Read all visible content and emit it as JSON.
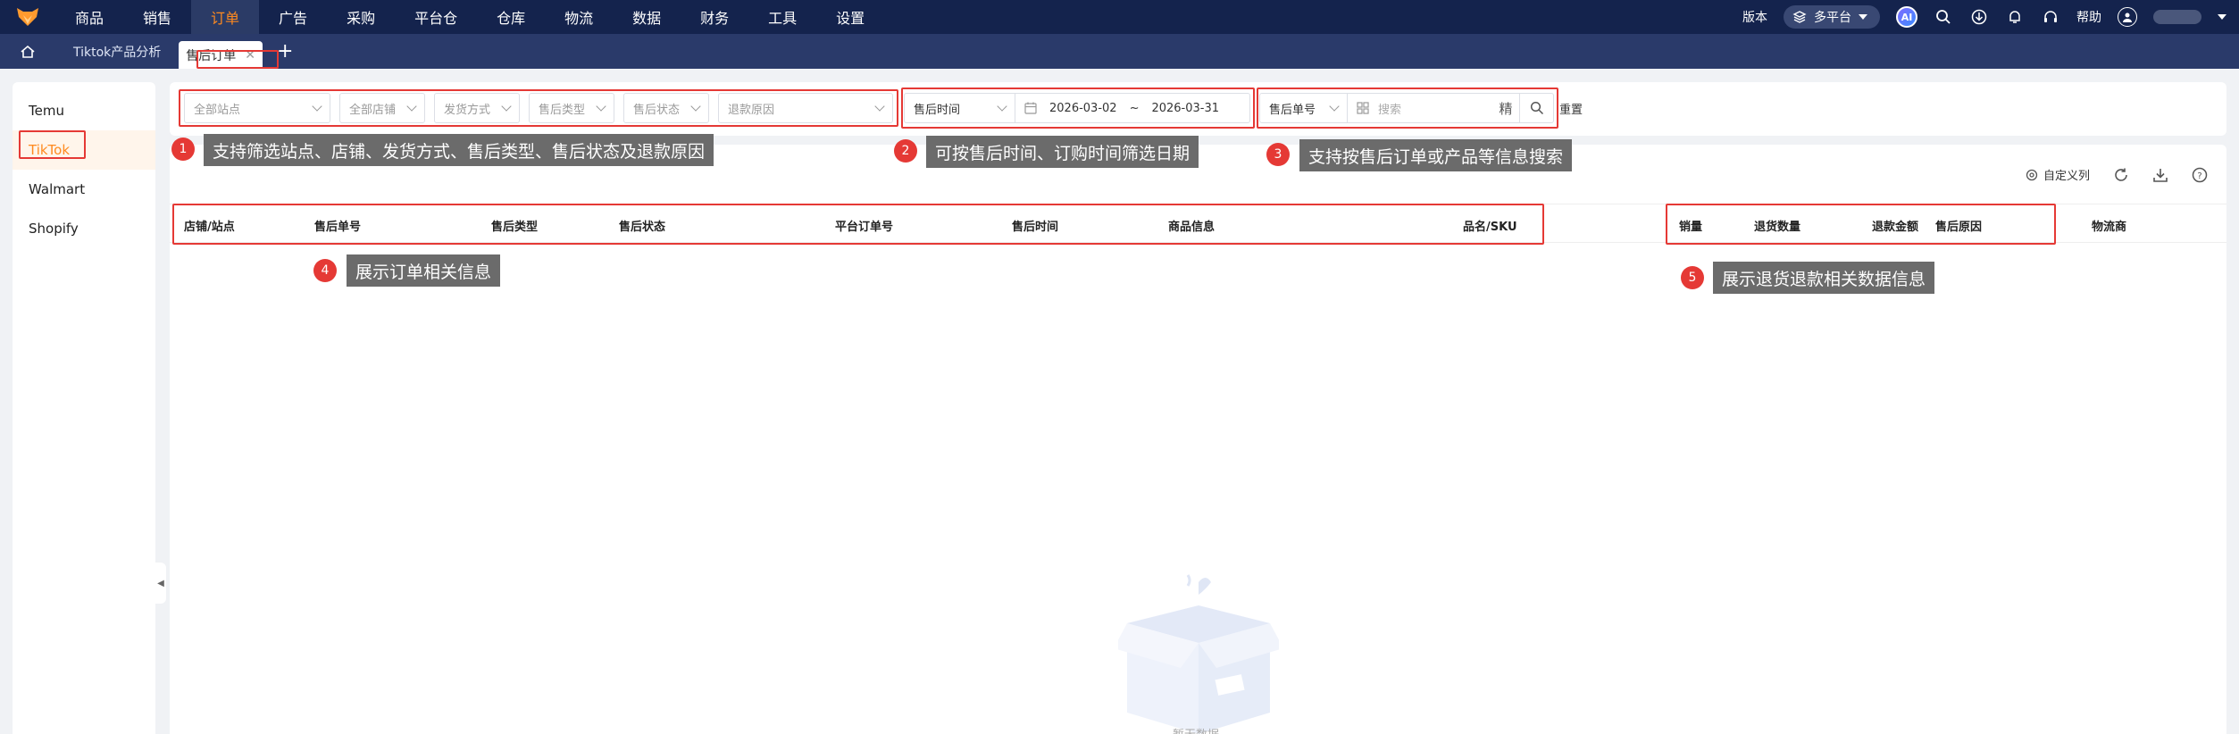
{
  "nav": {
    "items": [
      "商品",
      "销售",
      "订单",
      "广告",
      "采购",
      "平台仓",
      "仓库",
      "物流",
      "数据",
      "财务",
      "工具",
      "设置"
    ],
    "active_index": 2,
    "version_label": "版本",
    "platform_label": "多平台",
    "ai_label": "AI",
    "help_label": "帮助"
  },
  "tabs": {
    "items": [
      "Tiktok产品分析",
      "售后订单"
    ],
    "active_index": 1,
    "add_label": "+"
  },
  "sidebar": {
    "items": [
      "Temu",
      "TikTok",
      "Walmart",
      "Shopify"
    ],
    "active_index": 1
  },
  "filters": {
    "site": "全部站点",
    "shop": "全部店铺",
    "ship_method": "发货方式",
    "after_type": "售后类型",
    "after_status": "售后状态",
    "refund_reason": "退款原因",
    "date_type": "售后时间",
    "date_start": "2026-03-02",
    "date_sep": "~",
    "date_end": "2026-03-31",
    "search_type": "售后单号",
    "search_placeholder": "搜索",
    "precise_label": "精",
    "reset_label": "重置"
  },
  "toolbar": {
    "custom_columns": "自定义列"
  },
  "table": {
    "columns": [
      "店铺/站点",
      "售后单号",
      "售后类型",
      "售后状态",
      "平台订单号",
      "售后时间",
      "商品信息",
      "品名/SKU",
      "销量",
      "退货数量",
      "退款金额",
      "售后原因",
      "物流商"
    ],
    "empty_text": "暂无数据"
  },
  "annotations": [
    {
      "num": "1",
      "text": "支持筛选站点、店铺、发货方式、售后类型、售后状态及退款原因"
    },
    {
      "num": "2",
      "text": "可按售后时间、订购时间筛选日期"
    },
    {
      "num": "3",
      "text": "支持按售后订单或产品等信息搜索"
    },
    {
      "num": "4",
      "text": "展示订单相关信息"
    },
    {
      "num": "5",
      "text": "展示退货退款相关数据信息"
    }
  ],
  "colors": {
    "nav_bg": "#14234d",
    "tabbar_bg": "#2a3a6a",
    "accent": "#ff8a1f",
    "annotation_red": "#e53935"
  }
}
